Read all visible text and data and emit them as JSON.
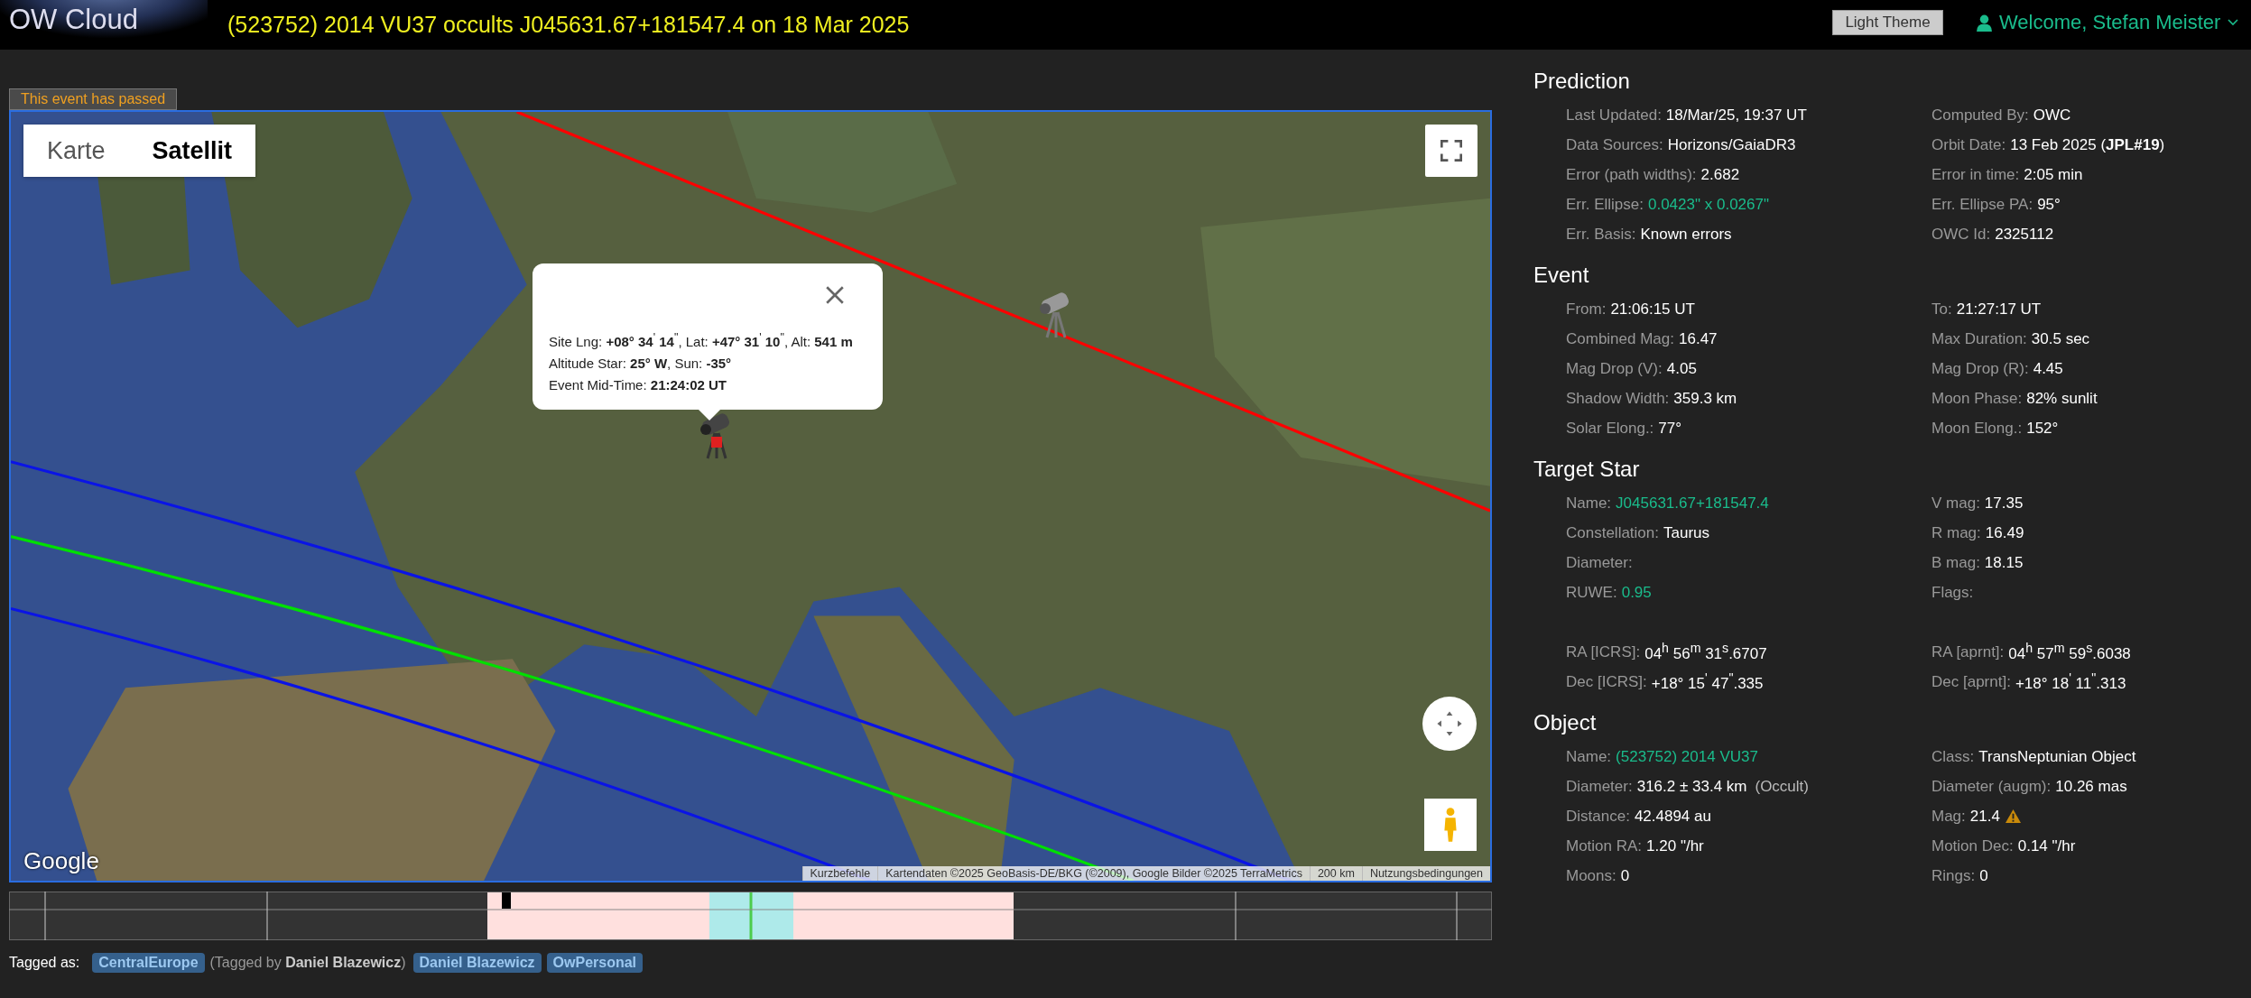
{
  "header": {
    "logo": "OW Cloud",
    "title": "(523752) 2014 VU37 occults J045631.67+181547.4 on 18 Mar 2025",
    "theme_button": "Light Theme",
    "user": "Welcome, Stefan Meister"
  },
  "notice": "This event has passed",
  "map": {
    "map_types": [
      {
        "label": "Karte",
        "selected": false
      },
      {
        "label": "Satellit",
        "selected": true
      }
    ],
    "popup": {
      "lines": [
        "Site Lng: **+08° 34**$^{'}$ **14**$^{\"}$, Lat: **+47° 31**$^{'}$ **10**$^{\"}$, Alt: **541 m**",
        "Altitude Star: **25° W**, Sun: **-35°**",
        "Event Mid-Time: **21:24:02 UT**"
      ]
    },
    "logo": "Google",
    "attribution": [
      "Kurzbefehle",
      "Kartendaten ©2025 GeoBasis-DE/BKG (©2009), Google Bilder ©2025 TerraMetrics",
      "200 km",
      "Nutzungsbedingungen"
    ]
  },
  "sections": [
    {
      "title": "Prediction",
      "groups": [
        [
          {
            "left": {
              "label": "Last Updated:",
              "value": "18/Mar/25, 19:37 UT",
              "kind": "text"
            },
            "right": {
              "label": "Computed By:",
              "value": "OWC",
              "kind": "text"
            }
          },
          {
            "left": {
              "label": "Data Sources:",
              "value": "Horizons/GaiaDR3",
              "kind": "text"
            },
            "right": {
              "label": "Orbit Date:",
              "value": "13 Feb 2025 (**JPL#19**)",
              "kind": "text"
            }
          },
          {
            "left": {
              "label": "Error (path widths):",
              "value": "2.682",
              "kind": "text"
            },
            "right": {
              "label": "Error in time:",
              "value": "2:05 min",
              "kind": "text"
            }
          },
          {
            "left": {
              "label": "Err. Ellipse:",
              "value": "0.0423\" x 0.0267\"",
              "kind": "link"
            },
            "right": {
              "label": "Err. Ellipse PA:",
              "value": "95°",
              "kind": "text"
            }
          },
          {
            "left": {
              "label": "Err. Basis:",
              "value": "Known errors",
              "kind": "text"
            },
            "right": {
              "label": "OWC Id:",
              "value": "2325112",
              "kind": "text"
            }
          }
        ]
      ]
    },
    {
      "title": "Event",
      "groups": [
        [
          {
            "left": {
              "label": "From:",
              "value": "21:06:15 UT",
              "kind": "text"
            },
            "right": {
              "label": "To:",
              "value": "21:27:17 UT",
              "kind": "text"
            }
          },
          {
            "left": {
              "label": "Combined Mag:",
              "value": "16.47",
              "kind": "text"
            },
            "right": {
              "label": "Max Duration:",
              "value": "30.5 sec",
              "kind": "text"
            }
          },
          {
            "left": {
              "label": "Mag Drop (V):",
              "value": "4.05",
              "kind": "text"
            },
            "right": {
              "label": "Mag Drop (R):",
              "value": "4.45",
              "kind": "text"
            }
          },
          {
            "left": {
              "label": "Shadow Width:",
              "value": "359.3 km",
              "kind": "text"
            },
            "right": {
              "label": "Moon Phase:",
              "value": "82% sunlit",
              "kind": "text"
            }
          },
          {
            "left": {
              "label": "Solar Elong.:",
              "value": "77°",
              "kind": "text"
            },
            "right": {
              "label": "Moon Elong.:",
              "value": "152°",
              "kind": "text"
            }
          }
        ]
      ]
    },
    {
      "title": "Target Star",
      "groups": [
        [
          {
            "left": {
              "label": "Name:",
              "value": "J045631.67+181547.4",
              "kind": "link"
            },
            "right": {
              "label": "V mag:",
              "value": "17.35",
              "kind": "text"
            }
          },
          {
            "left": {
              "label": "Constellation:",
              "value": "Taurus",
              "kind": "text"
            },
            "right": {
              "label": "R mag:",
              "value": "16.49",
              "kind": "text"
            }
          },
          {
            "left": {
              "label": "Diameter:",
              "kind": "text"
            },
            "right": {
              "label": "B mag:",
              "value": "18.15",
              "kind": "text"
            }
          },
          {
            "left": {
              "label": "RUWE:",
              "value": "0.95",
              "kind": "link"
            },
            "right": {
              "label": "Flags:",
              "kind": "text"
            }
          }
        ],
        [
          {
            "left": {
              "label": "RA [ICRS]:",
              "value": "04$^{h}$ 56$^{m}$ 31$^{s}$.6707",
              "kind": "text"
            },
            "right": {
              "label": "RA [aprnt]:",
              "value": "04$^{h}$ 57$^{m}$ 59$^{s}$.6038",
              "kind": "text"
            }
          },
          {
            "left": {
              "label": "Dec [ICRS]:",
              "value": "+18° 15$^{'}$ 47$^{\"}$.335",
              "kind": "text"
            },
            "right": {
              "label": "Dec [aprnt]:",
              "value": "+18° 18$^{'}$ 11$^{\"}$.313",
              "kind": "text"
            }
          }
        ]
      ]
    },
    {
      "title": "Object",
      "groups": [
        [
          {
            "left": {
              "label": "Name:",
              "value": "(523752) 2014 VU37",
              "kind": "link"
            },
            "right": {
              "label": "Class:",
              "value": "TransNeptunian Object",
              "kind": "text"
            }
          },
          {
            "left": {
              "label": "Diameter:",
              "value": "316.2 ± 33.4 km",
              "note": "(Occult)",
              "kind": "text"
            },
            "right": {
              "label": "Diameter (augm):",
              "value": "10.26 mas",
              "kind": "text"
            }
          },
          {
            "left": {
              "label": "Distance:",
              "value": "42.4894 au",
              "kind": "text"
            },
            "right": {
              "label": "Mag:",
              "value": "21.4",
              "kind": "warning"
            }
          },
          {
            "left": {
              "label": "Motion RA:",
              "value": "1.20 \"/hr",
              "kind": "text"
            },
            "right": {
              "label": "Motion Dec:",
              "value": "0.14 \"/hr",
              "kind": "text"
            }
          },
          {
            "left": {
              "label": "Moons:",
              "value": "0",
              "kind": "text"
            },
            "right": {
              "label": "Rings:",
              "value": "0",
              "kind": "text"
            }
          }
        ]
      ]
    }
  ],
  "tags": {
    "label": "Tagged as:",
    "items": [
      {
        "label": "CentralEurope",
        "note": "(Tagged by **Daniel Blazewicz**)"
      },
      {
        "label": "Daniel Blazewicz"
      },
      {
        "label": "OwPersonal"
      }
    ]
  }
}
